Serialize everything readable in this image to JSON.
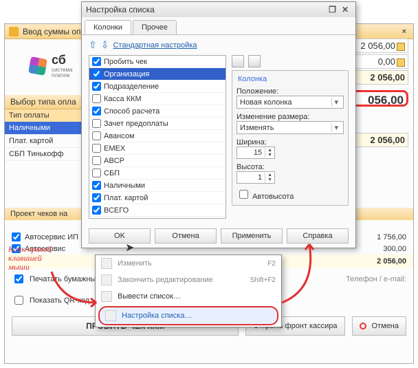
{
  "back_window": {
    "title": "Ввод суммы оп",
    "logo_main": "сб",
    "logo_sub1": "система",
    "logo_sub2": "платеж",
    "payment_header": "Выбор типа опла",
    "col_header": "Тип оплаты",
    "rows": [
      "Наличными",
      "Плат. картой",
      "СБП Тинькофф"
    ],
    "proj_header": "Проект чеков на",
    "item1": "Автосервис ИП",
    "item2": "Автосервис",
    "val1": "1 756,00",
    "val2": "300,00",
    "total": "2 056,00",
    "chk_paper": "Печатать бумажный чек",
    "mid_label": "Телефон / e-mail:",
    "chk_qr": "Показать QR-код",
    "btn_main": "ПРОБИТЬ ЧЕК ККМ",
    "btn_front": "Открыть фронт кассира",
    "btn_cancel": "Отмена"
  },
  "right_values": {
    "v1": "2 056,00",
    "v2": "0,00",
    "v3": "2 056,00",
    "v4": "056,00",
    "v5": "2 056,00"
  },
  "dialog": {
    "title": "Настройка списка",
    "tab1": "Колонки",
    "tab2": "Прочее",
    "std_link": "Стандартная настройка",
    "items": [
      {
        "label": "Пробить чек",
        "checked": true,
        "sel": false
      },
      {
        "label": "Организация",
        "checked": true,
        "sel": true
      },
      {
        "label": "Подразделение",
        "checked": true,
        "sel": false
      },
      {
        "label": "Касса ККМ",
        "checked": false,
        "sel": false
      },
      {
        "label": "Способ расчета",
        "checked": true,
        "sel": false
      },
      {
        "label": "Зачет предоплаты",
        "checked": false,
        "sel": false
      },
      {
        "label": "Авансом",
        "checked": false,
        "sel": false
      },
      {
        "label": "EMEX",
        "checked": false,
        "sel": false
      },
      {
        "label": "ABCP",
        "checked": false,
        "sel": false
      },
      {
        "label": "СБП",
        "checked": false,
        "sel": false
      },
      {
        "label": "Наличными",
        "checked": true,
        "sel": false
      },
      {
        "label": "Плат. картой",
        "checked": true,
        "sel": false
      },
      {
        "label": "ВСЕГО",
        "checked": true,
        "sel": false
      }
    ],
    "group_title": "Колонка",
    "pos_label": "Положение:",
    "pos_value": "Новая колонка",
    "resize_label": "Изменение размера:",
    "resize_value": "Изменять",
    "width_label": "Ширина:",
    "width_value": "15",
    "height_label": "Высота:",
    "height_value": "1",
    "auto_label": "Автовысота",
    "ok": "OK",
    "cancel": "Отмена",
    "apply": "Применить",
    "help": "Справка"
  },
  "context": {
    "edit": "Изменить",
    "edit_sc": "F2",
    "finish": "Закончить редактирование",
    "finish_sc": "Shift+F2",
    "export": "Вывести список…",
    "settings": "Настройка списка…"
  },
  "annotation": "Клик правой\nклавишей\nмыши"
}
